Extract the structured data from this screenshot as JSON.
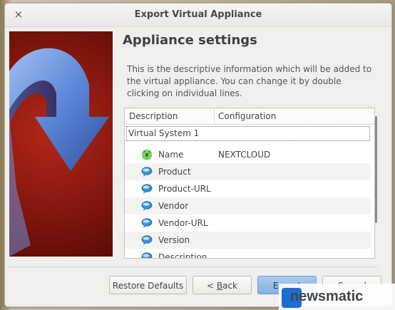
{
  "window": {
    "title": "Export Virtual Appliance",
    "close_glyph": "×"
  },
  "page": {
    "heading": "Appliance settings",
    "description": "This is the descriptive information which will be added to the virtual appliance. You can change it by double clicking on individual lines."
  },
  "tree": {
    "columns": [
      "Description",
      "Configuration"
    ],
    "group": "Virtual System 1",
    "rows": [
      {
        "label": "Name",
        "value": "NEXTCLOUD",
        "icon": "name-tag-icon"
      },
      {
        "label": "Product",
        "value": "",
        "icon": "speech-bubble-icon"
      },
      {
        "label": "Product-URL",
        "value": "",
        "icon": "speech-bubble-icon"
      },
      {
        "label": "Vendor",
        "value": "",
        "icon": "speech-bubble-icon"
      },
      {
        "label": "Vendor-URL",
        "value": "",
        "icon": "speech-bubble-icon"
      },
      {
        "label": "Version",
        "value": "",
        "icon": "speech-bubble-icon"
      },
      {
        "label": "Description",
        "value": "",
        "icon": "speech-bubble-icon"
      }
    ]
  },
  "buttons": {
    "restore": "Restore Defaults",
    "back_prefix": "< ",
    "back_mnemonic": "B",
    "back_rest": "ack",
    "export": "Export",
    "cancel": "Cancel"
  },
  "watermark": {
    "text": "newsmatic"
  },
  "colors": {
    "accent": "#84b1e3",
    "side_image": "#8e1a10",
    "arrow": "#5b86d6"
  }
}
